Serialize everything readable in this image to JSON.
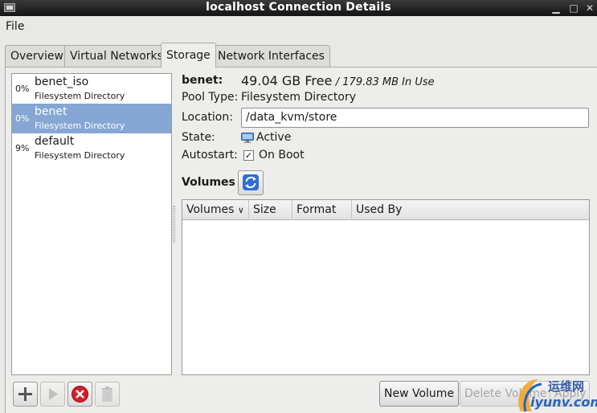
{
  "window": {
    "title": "localhost Connection Details"
  },
  "menu": {
    "file": "File"
  },
  "tabs": [
    {
      "label": "Overview"
    },
    {
      "label": "Virtual Networks"
    },
    {
      "label": "Storage",
      "active": true
    },
    {
      "label": "Network Interfaces"
    }
  ],
  "pools": [
    {
      "percent": "0%",
      "name": "benet_iso",
      "type": "Filesystem Directory"
    },
    {
      "percent": "0%",
      "name": "benet",
      "type": "Filesystem Directory",
      "selected": true
    },
    {
      "percent": "9%",
      "name": "default",
      "type": "Filesystem Directory"
    }
  ],
  "details": {
    "name": "benet:",
    "free": "49.04 GB Free",
    "used": "/ 179.83 MB In Use",
    "pool_type_label": "Pool Type:",
    "pool_type": "Filesystem Directory",
    "location_label": "Location:",
    "location": "/data_kvm/store",
    "state_label": "State:",
    "state": "Active",
    "autostart_label": "Autostart:",
    "autostart": "On Boot",
    "autostart_checked": true,
    "volumes_label": "Volumes"
  },
  "volumes_table": {
    "columns": [
      "Volumes",
      "Size",
      "Format",
      "Used By"
    ],
    "rows": []
  },
  "buttons": {
    "new_volume": "New Volume",
    "delete_volume": "Delete Volume",
    "apply": "Apply"
  },
  "watermark": {
    "line1": "运维网",
    "line2": "iyunv.com"
  },
  "icons": {
    "add": "plus-icon",
    "start": "play-icon",
    "stop": "stop-icon",
    "delete": "trash-icon",
    "refresh": "refresh-icon",
    "state": "monitor-icon"
  },
  "colors": {
    "selection": "#86a6d4",
    "stop": "#d0202a",
    "refresh": "#2f6fd0"
  }
}
